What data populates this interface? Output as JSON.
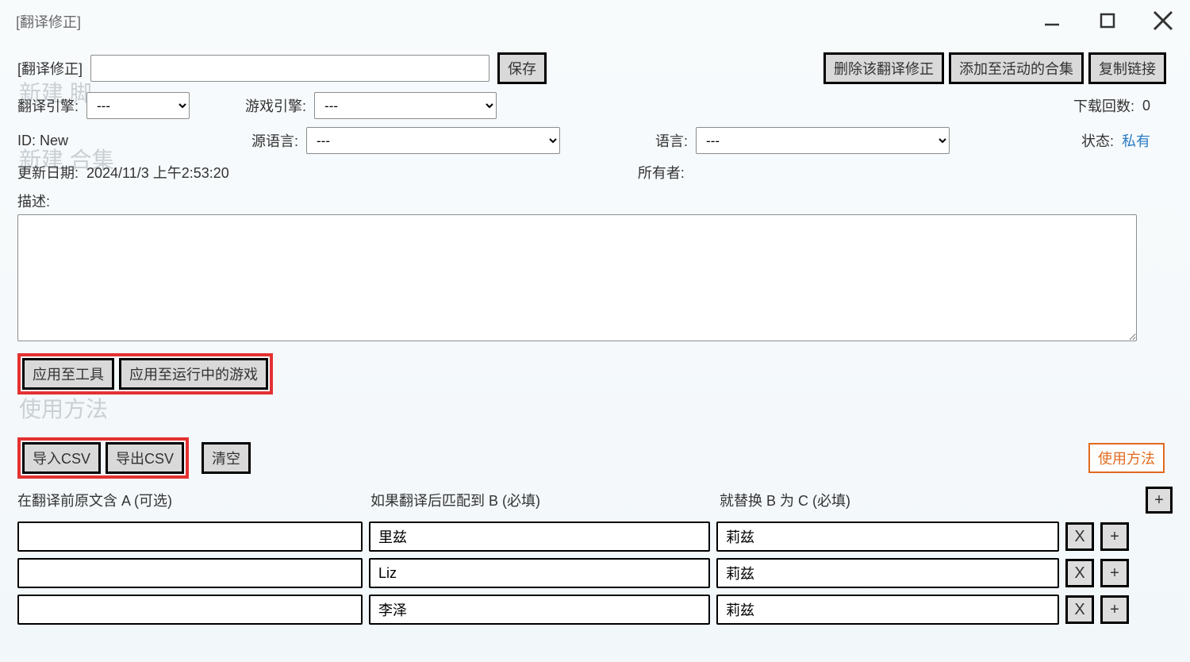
{
  "window": {
    "title": "[翻译修正]"
  },
  "header": {
    "label_prefix": "[翻译修正]",
    "name_value": "",
    "save": "保存",
    "delete": "删除该翻译修正",
    "add_to_collection": "添加至活动的合集",
    "copy_link": "复制链接"
  },
  "row2": {
    "engine_label": "翻译引擎:",
    "engine_select": "---",
    "game_engine_label": "游戏引擎:",
    "game_engine_select": "---",
    "download_label": "下载回数:",
    "download_count": "0"
  },
  "row3": {
    "id_label": "ID: New",
    "source_lang_label": "源语言:",
    "source_lang_select": "---",
    "lang_label": "语言:",
    "lang_select": "---",
    "status_label": "状态:",
    "status_value": "私有"
  },
  "row4": {
    "update_label": "更新日期:",
    "update_value": "2024/11/3 上午2:53:20",
    "owner_label": "所有者:",
    "owner_value": ""
  },
  "desc": {
    "label": "描述:",
    "value": ""
  },
  "apply": {
    "to_tool": "应用至工具",
    "to_game": "应用至运行中的游戏"
  },
  "csv": {
    "import": "导入CSV",
    "export": "导出CSV",
    "clear": "清空",
    "usage": "使用方法"
  },
  "columns": {
    "a": "在翻译前原文含 A (可选)",
    "b": "如果翻译后匹配到 B (必填)",
    "c": "就替换 B 为 C (必填)"
  },
  "rows": [
    {
      "a": "",
      "b": "里兹",
      "c": "莉兹"
    },
    {
      "a": "",
      "b": "Liz",
      "c": "莉兹"
    },
    {
      "a": "",
      "b": "李泽",
      "c": "莉兹"
    }
  ],
  "icons": {
    "x": "X",
    "plus": "+"
  },
  "ghost": {
    "g1": "新建 脚…",
    "g2": "新建 合集",
    "g3": "使用方法",
    "g4": ""
  }
}
